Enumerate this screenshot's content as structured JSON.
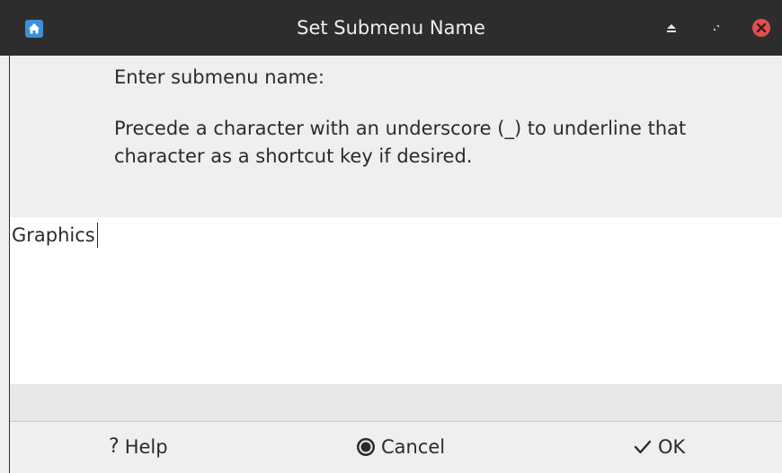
{
  "window": {
    "title": "Set Submenu Name",
    "title_bar_color": "#2d2d2d",
    "close_color": "#e0504d",
    "app_icon": "home-icon",
    "controls": [
      "shade-icon",
      "restore-icon",
      "close-icon"
    ]
  },
  "dialog": {
    "prompt": "Enter submenu name:",
    "hint_line1": "Precede a character with an underscore (_) to underline that",
    "hint_line2": "character as a shortcut key if desired.",
    "entry_value": "Graphics"
  },
  "buttons": {
    "help_icon": "?",
    "help_label": "Help",
    "cancel_icon": "cancel-circle-icon",
    "cancel_label": "Cancel",
    "ok_icon": "checkmark-icon",
    "ok_label": "OK"
  }
}
